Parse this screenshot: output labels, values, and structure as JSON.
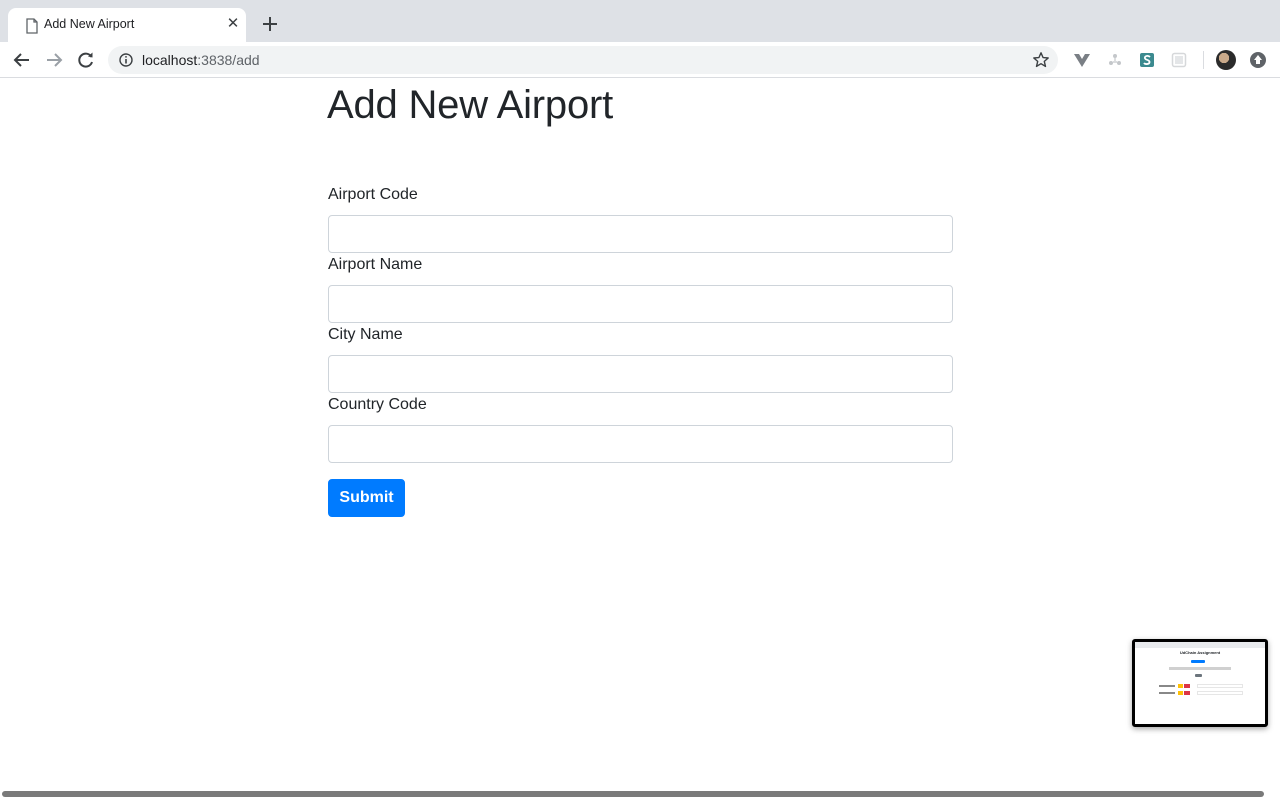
{
  "browser": {
    "tab_title": "Add New Airport",
    "tab_close": "✕",
    "url_host": "localhost",
    "url_rest": ":3838/add",
    "icons": [
      "doc-icon",
      "close-icon",
      "plus-icon",
      "back-icon",
      "forward-icon",
      "reload-icon",
      "info-icon",
      "star-icon",
      "vue-devtools-icon",
      "extension-icon",
      "s-extension-icon",
      "extension-icon",
      "avatar",
      "update-icon"
    ]
  },
  "form": {
    "title": "Add New Airport",
    "fields": [
      {
        "label": "Airport Code",
        "value": "",
        "placeholder": ""
      },
      {
        "label": "Airport Name",
        "value": "",
        "placeholder": ""
      },
      {
        "label": "City Name",
        "value": "",
        "placeholder": ""
      },
      {
        "label": "Country Code",
        "value": "",
        "placeholder": ""
      }
    ],
    "submit_label": "Submit"
  },
  "thumbnail": {
    "title": "UdChain Assignment"
  },
  "colors": {
    "primary": "#007bff",
    "text": "#212529",
    "input_border": "#ced4da",
    "tabstrip": "#dee1e6",
    "omnibox": "#f1f3f4"
  }
}
